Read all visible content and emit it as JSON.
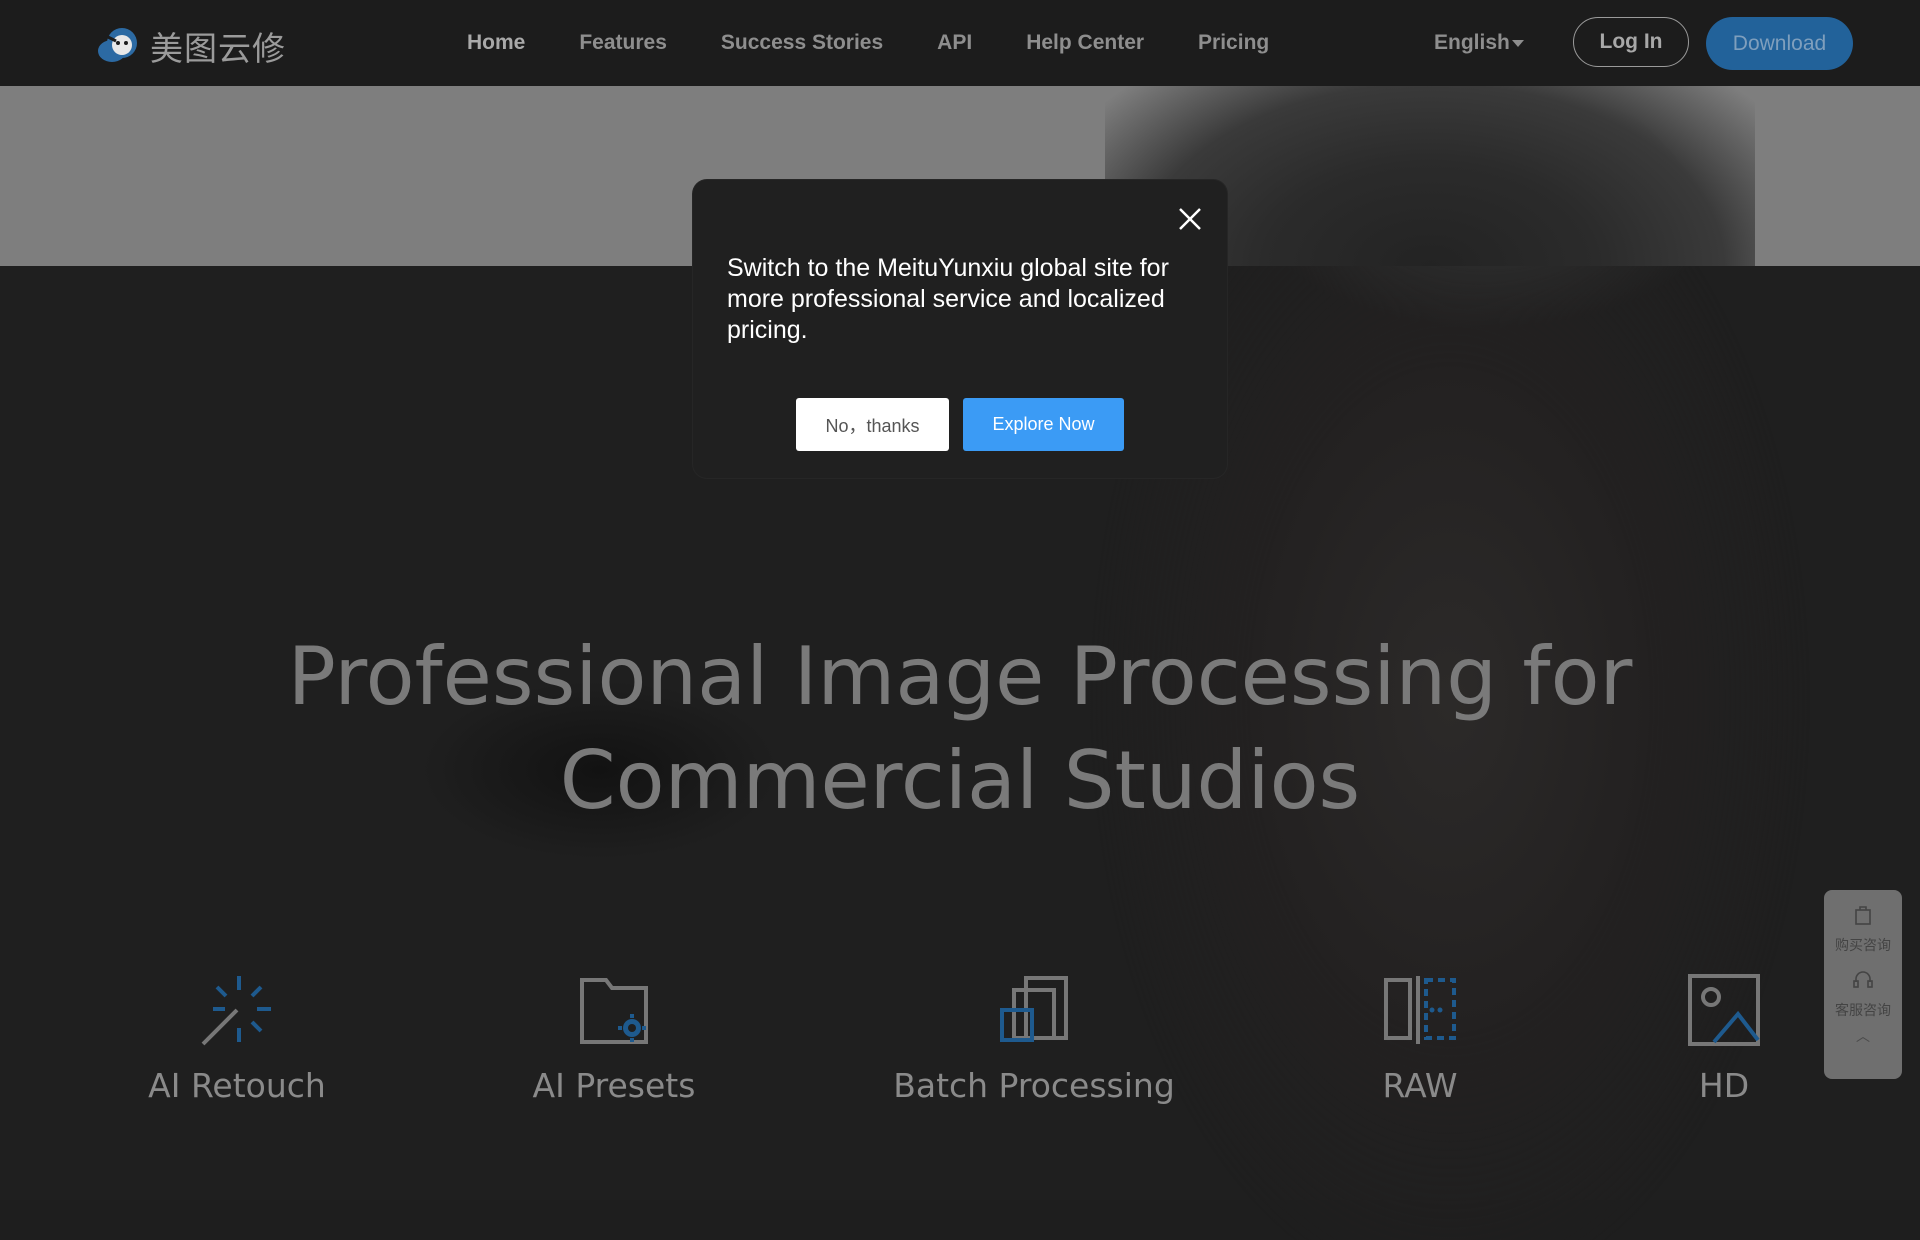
{
  "header": {
    "logo_text": "美图云修",
    "nav": [
      {
        "label": "Home"
      },
      {
        "label": "Features"
      },
      {
        "label": "Success Stories"
      },
      {
        "label": "API"
      },
      {
        "label": "Help Center"
      },
      {
        "label": "Pricing"
      }
    ],
    "language": "English",
    "login_label": "Log In",
    "download_label": "Download"
  },
  "hero": {
    "title_line1": "Professional Image Processing for",
    "title_line2": "Commercial Studios"
  },
  "features": [
    {
      "label": "AI Retouch",
      "icon": "magic-wand-icon"
    },
    {
      "label": "AI Presets",
      "icon": "folder-gear-icon"
    },
    {
      "label": "Batch Processing",
      "icon": "stacked-squares-icon"
    },
    {
      "label": "RAW",
      "icon": "raw-compare-icon"
    },
    {
      "label": "HD",
      "icon": "image-icon"
    }
  ],
  "side_widget": {
    "purchase_label": "购买咨询",
    "service_label": "客服咨询",
    "up_glyph": "︿"
  },
  "modal": {
    "message": "Switch to the MeituYunxiu global site for more professional service and localized pricing.",
    "no_label": "No，thanks",
    "explore_label": "Explore Now"
  },
  "colors": {
    "accent_blue": "#3b9bf5",
    "download_blue": "#22629a",
    "icon_blue": "#1e5a8e",
    "background": "#1e1e1e"
  }
}
